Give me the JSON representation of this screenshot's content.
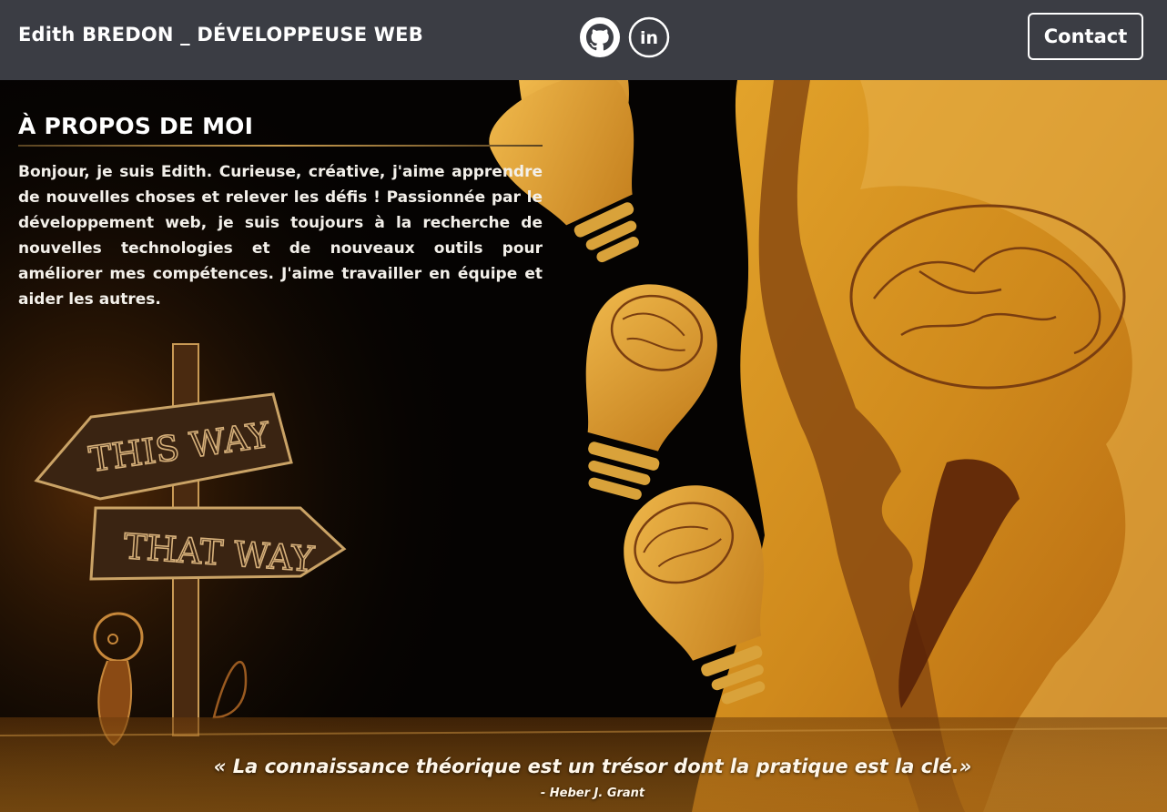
{
  "header": {
    "title": "Edith BREDON _ DÉVELOPPEUSE WEB",
    "socials": [
      {
        "icon": "github-icon",
        "label": "GitHub"
      },
      {
        "icon": "linkedin-icon",
        "label": "in"
      }
    ],
    "contact_label": "Contact"
  },
  "about": {
    "title": "À PROPOS DE MOI",
    "text": "Bonjour, je suis Edith. Curieuse, créative, j'aime apprendre de nouvelles choses et relever les défis ! Passionnée par le développement web, je suis toujours à la recherche de nouvelles technologies et de nouveaux outils pour améliorer mes compétences. J'aime travailler en équipe et aider les autres."
  },
  "illustration": {
    "sign_top": "THIS WAY",
    "sign_bottom": "THAT WAY"
  },
  "quote": {
    "text": "« La connaissance théorique est un trésor dont la pratique est la clé.»",
    "author": "- Heber J. Grant"
  },
  "colors": {
    "header_bg": "#3b3d44",
    "accent_gold": "#d9a23a",
    "dark_bg": "#050302"
  }
}
